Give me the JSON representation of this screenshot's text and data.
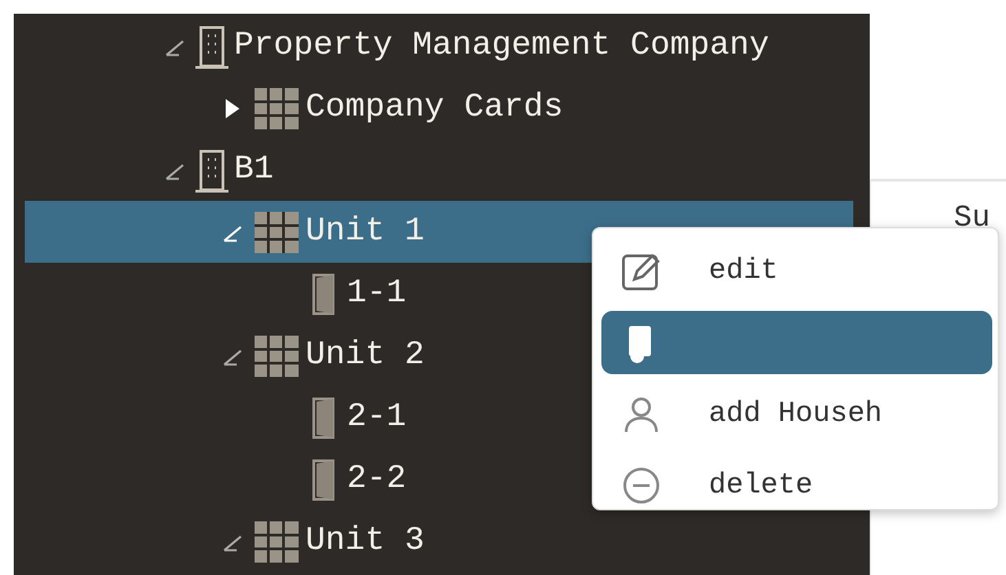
{
  "tree": [
    {
      "label": "Property Management Company",
      "kind": "building",
      "expanded": true,
      "selected": false,
      "children": [
        {
          "label": "Company Cards",
          "kind": "unit",
          "expanded": false,
          "selected": false
        }
      ]
    },
    {
      "label": "B1",
      "kind": "building",
      "expanded": true,
      "selected": false,
      "children": [
        {
          "label": "Unit 1",
          "kind": "unit",
          "expanded": true,
          "selected": true,
          "children": [
            {
              "label": "1-1",
              "kind": "room",
              "selected": false
            }
          ]
        },
        {
          "label": "Unit 2",
          "kind": "unit",
          "expanded": true,
          "selected": false,
          "children": [
            {
              "label": "2-1",
              "kind": "room",
              "selected": false
            },
            {
              "label": "2-2",
              "kind": "room",
              "selected": false
            }
          ]
        },
        {
          "label": "Unit 3",
          "kind": "unit",
          "expanded": true,
          "selected": false
        }
      ]
    }
  ],
  "side_panel": {
    "label": "Su"
  },
  "context_menu": [
    {
      "kind": "edit",
      "label": "edit",
      "selected": false
    },
    {
      "kind": "card",
      "selected": true
    },
    {
      "kind": "person",
      "label": "add Househ",
      "selected": false
    },
    {
      "kind": "delete",
      "label": "delete",
      "selected": false
    }
  ]
}
